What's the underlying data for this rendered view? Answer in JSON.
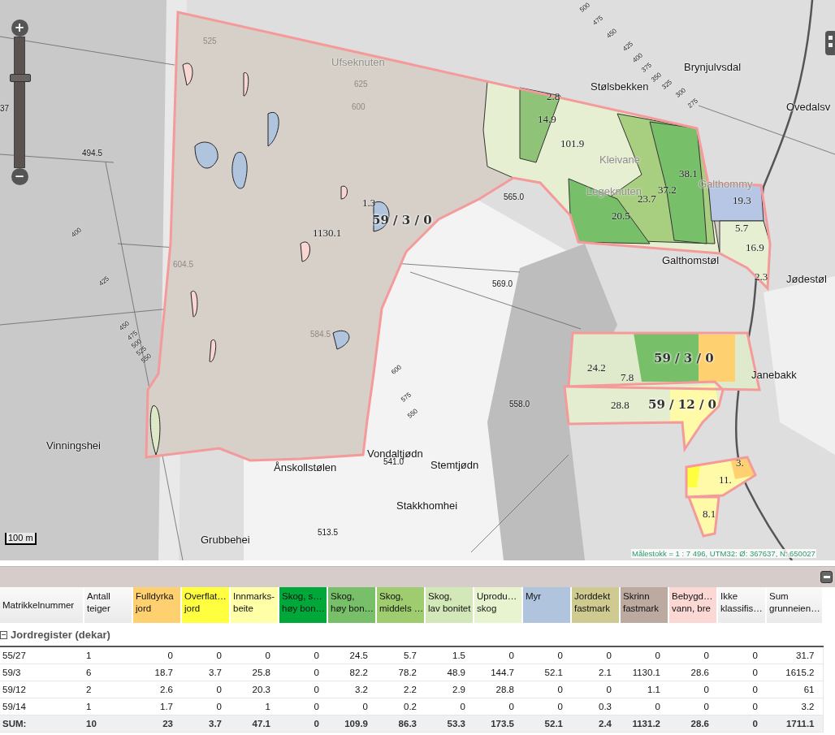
{
  "map": {
    "zoom": {
      "zoom_in": "+",
      "zoom_out": "−",
      "level": 0.7
    },
    "labels": [
      {
        "text": "500",
        "kind": "contour"
      },
      {
        "text": "475",
        "kind": "contour"
      },
      {
        "text": "525",
        "kind": "spot-faded"
      },
      {
        "text": "450",
        "kind": "contour"
      },
      {
        "text": "Ufseknuten",
        "kind": "place-faded"
      },
      {
        "text": "425",
        "kind": "contour"
      },
      {
        "text": "400",
        "kind": "contour"
      },
      {
        "text": "Brynjulvsdal",
        "kind": "place"
      },
      {
        "text": "37",
        "kind": "spot"
      },
      {
        "text": "625",
        "kind": "spot-faded"
      },
      {
        "text": "600",
        "kind": "spot-faded"
      },
      {
        "text": "2.8",
        "kind": "area"
      },
      {
        "text": "Stølsbekken",
        "kind": "place"
      },
      {
        "text": "375",
        "kind": "contour"
      },
      {
        "text": "350",
        "kind": "contour"
      },
      {
        "text": "325",
        "kind": "contour"
      },
      {
        "text": "300",
        "kind": "contour"
      },
      {
        "text": "275",
        "kind": "contour"
      },
      {
        "text": "Ovedalsv",
        "kind": "place"
      },
      {
        "text": "14.9",
        "kind": "area"
      },
      {
        "text": "494.5",
        "kind": "spot"
      },
      {
        "text": "101.9",
        "kind": "area"
      },
      {
        "text": "Kleivane",
        "kind": "place-faded"
      },
      {
        "text": "38.1",
        "kind": "area"
      },
      {
        "text": "1.3",
        "kind": "area"
      },
      {
        "text": "565.0",
        "kind": "spot"
      },
      {
        "text": "Legeknuten",
        "kind": "place-faded"
      },
      {
        "text": "23.7",
        "kind": "area"
      },
      {
        "text": "37.2",
        "kind": "area"
      },
      {
        "text": "Galthommy",
        "kind": "place-faded"
      },
      {
        "text": "19.3",
        "kind": "area"
      },
      {
        "text": "59 / 3 / 0",
        "kind": "parcel"
      },
      {
        "text": "20.5",
        "kind": "area"
      },
      {
        "text": "400",
        "kind": "contour"
      },
      {
        "text": "1130.1",
        "kind": "area"
      },
      {
        "text": "5.7",
        "kind": "area"
      },
      {
        "text": "16.9",
        "kind": "area"
      },
      {
        "text": "604.5",
        "kind": "spot-faded"
      },
      {
        "text": "Galthomstøl",
        "kind": "place"
      },
      {
        "text": "425",
        "kind": "contour"
      },
      {
        "text": "569.0",
        "kind": "spot"
      },
      {
        "text": "2.3",
        "kind": "area"
      },
      {
        "text": "Jødestøl",
        "kind": "place"
      },
      {
        "text": "450",
        "kind": "contour"
      },
      {
        "text": "475",
        "kind": "contour"
      },
      {
        "text": "584.5",
        "kind": "spot-faded"
      },
      {
        "text": "500",
        "kind": "contour"
      },
      {
        "text": "525",
        "kind": "contour"
      },
      {
        "text": "550",
        "kind": "contour"
      },
      {
        "text": "24.2",
        "kind": "area"
      },
      {
        "text": "59 / 3 / 0",
        "kind": "parcel"
      },
      {
        "text": "600",
        "kind": "contour"
      },
      {
        "text": "7.8",
        "kind": "area"
      },
      {
        "text": "Janebakk",
        "kind": "place"
      },
      {
        "text": "575",
        "kind": "contour"
      },
      {
        "text": "550",
        "kind": "contour"
      },
      {
        "text": "558.0",
        "kind": "spot"
      },
      {
        "text": "28.8",
        "kind": "area"
      },
      {
        "text": "59 / 12 / 0",
        "kind": "parcel"
      },
      {
        "text": "Vinningshei",
        "kind": "place"
      },
      {
        "text": "Vondaltjødn",
        "kind": "place"
      },
      {
        "text": "Ånskollstølen",
        "kind": "place"
      },
      {
        "text": "541.0",
        "kind": "spot"
      },
      {
        "text": "Stemtjødn",
        "kind": "place"
      },
      {
        "text": "3.",
        "kind": "area"
      },
      {
        "text": "11.",
        "kind": "area"
      },
      {
        "text": "Stakkhomhei",
        "kind": "place"
      },
      {
        "text": "8.1",
        "kind": "area"
      },
      {
        "text": "Grubbehei",
        "kind": "place"
      },
      {
        "text": "513.5",
        "kind": "spot"
      }
    ],
    "scale_bar": "100 m",
    "status": "Målestokk = 1 : 7 496, UTM32: Ø: 367637, N: 650027"
  },
  "table": {
    "columns": [
      {
        "lines": [
          "Matrikkelnummer"
        ]
      },
      {
        "lines": [
          "Antall",
          "teiger"
        ]
      },
      {
        "lines": [
          "Fulldyrka",
          "jord"
        ],
        "color": "#ffd070"
      },
      {
        "lines": [
          "Overflat…",
          "jord"
        ],
        "color": "#ffff40"
      },
      {
        "lines": [
          "Innmarks-",
          "beite"
        ],
        "color": "#ffffa8"
      },
      {
        "lines": [
          "Skog, s…",
          "høy bon…"
        ],
        "color": "#00a83a"
      },
      {
        "lines": [
          "Skog,",
          "høy bon…"
        ],
        "color": "#78bf6a"
      },
      {
        "lines": [
          "Skog,",
          "middels …"
        ],
        "color": "#a0cc70"
      },
      {
        "lines": [
          "Skog,",
          "lav bonitet"
        ],
        "color": "#d2e8b8"
      },
      {
        "lines": [
          "Uprodu…",
          "skog"
        ],
        "color": "#e8f4d0"
      },
      {
        "lines": [
          "Myr"
        ],
        "color": "#b0c4de"
      },
      {
        "lines": [
          "Jorddekt",
          "fastmark"
        ],
        "color": "#cfca90"
      },
      {
        "lines": [
          "Skrinn",
          "fastmark"
        ],
        "color": "#bcaaa0"
      },
      {
        "lines": [
          "Bebygd…",
          "vann, bre"
        ],
        "color": "#fcd8d4"
      },
      {
        "lines": [
          "Ikke",
          "klassifis…"
        ]
      },
      {
        "lines": [
          "Sum",
          "grunneien…"
        ]
      }
    ],
    "group": {
      "title": "Jordregister (dekar)",
      "expanded": true
    },
    "rows": [
      {
        "cells": [
          "55/27",
          "1",
          "0",
          "0",
          "0",
          "0",
          "24.5",
          "5.7",
          "1.5",
          "0",
          "0",
          "0",
          "0",
          "0",
          "0",
          "31.7"
        ]
      },
      {
        "cells": [
          "59/3",
          "6",
          "18.7",
          "3.7",
          "25.8",
          "0",
          "82.2",
          "78.2",
          "48.9",
          "144.7",
          "52.1",
          "2.1",
          "1130.1",
          "28.6",
          "0",
          "1615.2"
        ]
      },
      {
        "cells": [
          "59/12",
          "2",
          "2.6",
          "0",
          "20.3",
          "0",
          "3.2",
          "2.2",
          "2.9",
          "28.8",
          "0",
          "0",
          "1.1",
          "0",
          "0",
          "61"
        ]
      },
      {
        "cells": [
          "59/14",
          "1",
          "1.7",
          "0",
          "1",
          "0",
          "0",
          "0.2",
          "0",
          "0",
          "0",
          "0.3",
          "0",
          "0",
          "0",
          "3.2"
        ]
      }
    ],
    "sum_row": {
      "cells": [
        "SUM:",
        "10",
        "23",
        "3.7",
        "47.1",
        "0",
        "109.9",
        "86.3",
        "53.3",
        "173.5",
        "52.1",
        "2.4",
        "1131.2",
        "28.6",
        "0",
        "1711.1"
      ]
    }
  }
}
